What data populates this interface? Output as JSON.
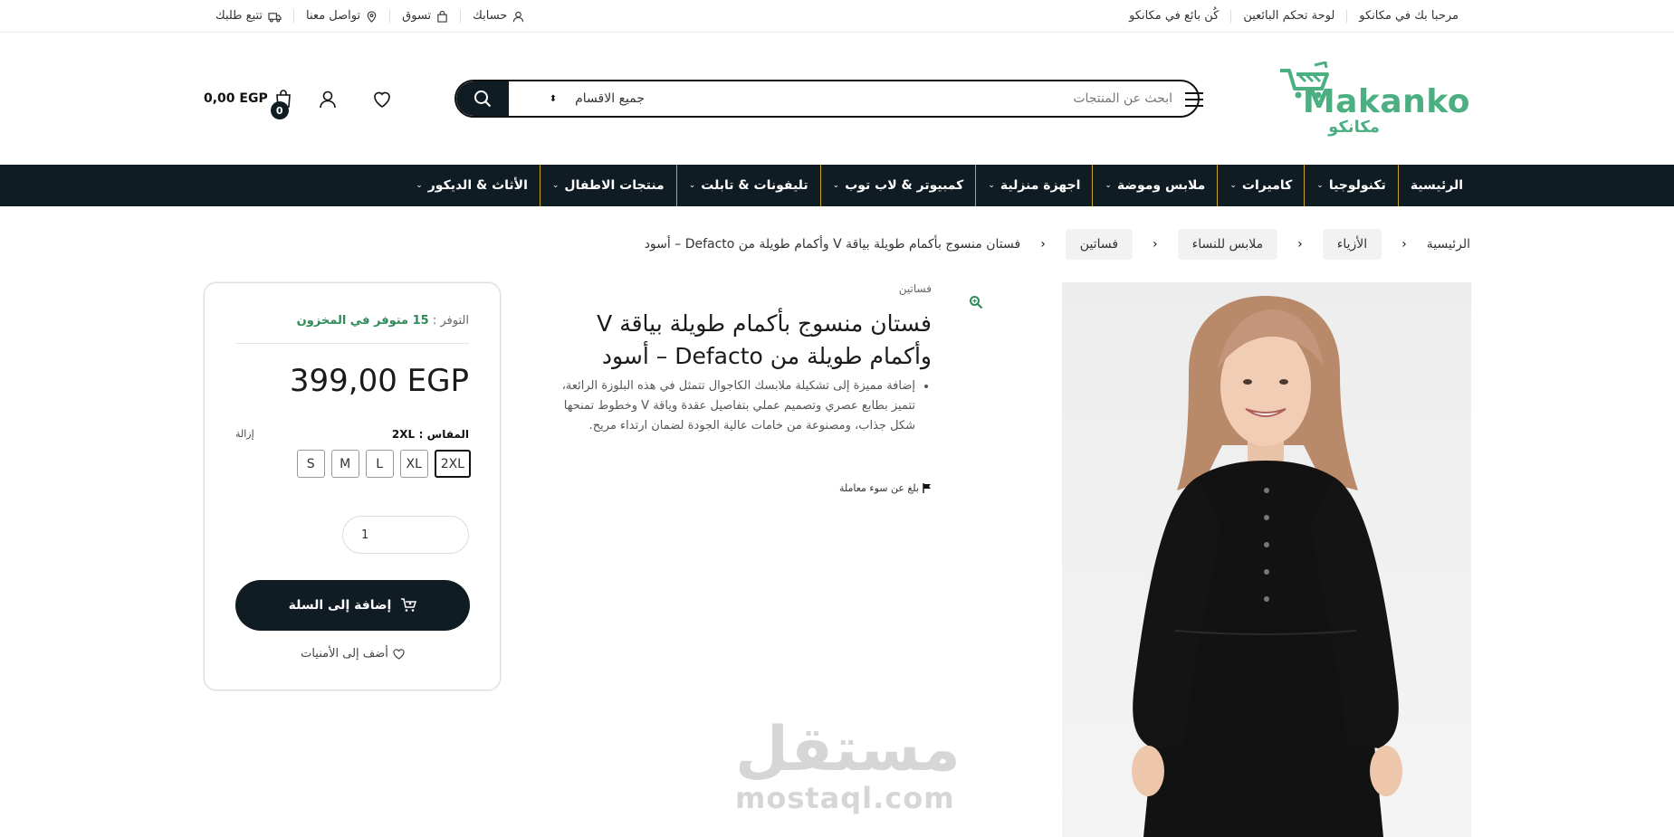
{
  "topbar": {
    "right_items": [
      {
        "label": "مرحبا بك في مكانكو"
      },
      {
        "label": "لوحة تحكم البائعين"
      },
      {
        "label": "كُن بائع في مكانكو"
      }
    ],
    "left_items": [
      {
        "label": "حسابك",
        "icon": "user-icon"
      },
      {
        "label": "تسوق",
        "icon": "bag-icon"
      },
      {
        "label": "تواصل معنا",
        "icon": "location-icon"
      },
      {
        "label": "تتبع طلبك",
        "icon": "truck-icon"
      }
    ]
  },
  "header": {
    "brand": "Makanko",
    "brand_ar": "مكانكو",
    "search_placeholder": "ابحث عن المنتجات",
    "search_category": "جميع الاقسام",
    "cart_amount": "0,00 EGP",
    "cart_count": "0"
  },
  "nav": {
    "items": [
      {
        "label": "الرئيسية",
        "dropdown": false
      },
      {
        "label": "تكنولوجيا",
        "dropdown": true
      },
      {
        "label": "كاميرات",
        "dropdown": true
      },
      {
        "label": "ملابس وموضة",
        "dropdown": true
      },
      {
        "label": "اجهزة منزلية",
        "dropdown": true
      },
      {
        "label": "كمبيوتر & لاب توب",
        "dropdown": true
      },
      {
        "label": "تليفونات & تابلت",
        "dropdown": true
      },
      {
        "label": "منتجات الاطفال",
        "dropdown": true
      },
      {
        "label": "الأثاث & الديكور",
        "dropdown": true
      }
    ]
  },
  "breadcrumb": {
    "home": "الرئيسية",
    "l1": "الأزياء",
    "l2": "ملابس للنساء",
    "l3": "فساتين",
    "current": "فستان منسوج بأكمام طويلة بياقة V وأكمام طويلة من Defacto – أسود"
  },
  "product": {
    "category": "فساتين",
    "title": "فستان منسوج بأكمام طويلة بياقة V وأكمام طويلة من Defacto – أسود",
    "description": "إضافة مميزة إلى تشكيلة ملابسك الكاجوال تتمثل في هذه البلوزة الرائعة، تتميز بطابع عصري وتصميم عملي بتفاصيل عقدة وياقة V وخطوط تمنحها شكل جذاب، ومصنوعة من خامات عالية الجودة لضمان ارتداء مريح.",
    "report": "بلغ عن سوء معاملة"
  },
  "buybox": {
    "availability_label": "التوفر :",
    "availability_value": "15 متوفر في المخزون",
    "price": "399,00 EGP",
    "size_label": "المقاس :",
    "size_selected": "2XL",
    "clear": "إزالة",
    "sizes": [
      "2XL",
      "XL",
      "L",
      "M",
      "S"
    ],
    "quantity": "1",
    "add_to_cart": "إضافة إلى السلة",
    "wishlist": "أضف إلى الأمنيات"
  },
  "watermark": {
    "ar": "مستقل",
    "en": "mostaql.com"
  },
  "colors": {
    "dark": "#101c24",
    "brand_green": "#4caf82",
    "stock_green": "#2e8b57",
    "nav_divider": "#c9a227"
  }
}
